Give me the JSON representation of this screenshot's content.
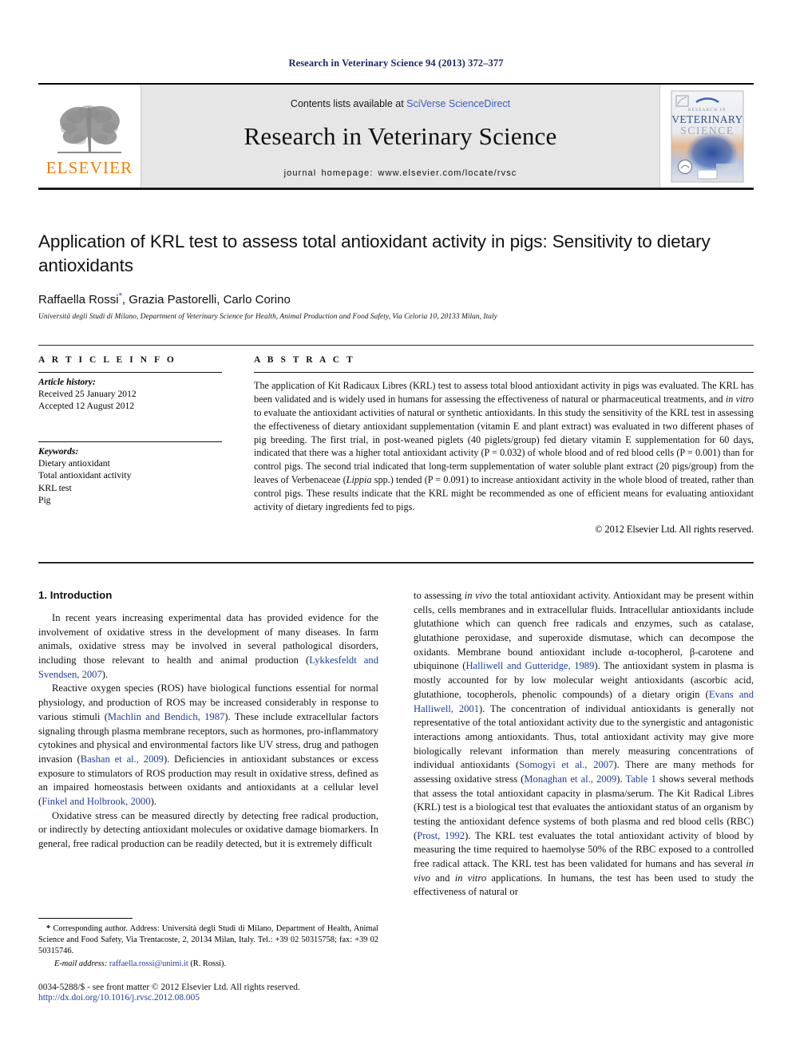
{
  "running_head": "Research in Veterinary Science 94 (2013) 372–377",
  "masthead": {
    "publisher_logo_text": "ELSEVIER",
    "contents_prefix": "Contents lists available at ",
    "contents_link": "SciVerse ScienceDirect",
    "journal_title": "Research in Veterinary Science",
    "homepage_label": "journal homepage: www.elsevier.com/locate/rvsc",
    "cover": {
      "line1": "RESEARCH IN",
      "line2": "VETERINARY",
      "line3": "SCIENCE"
    }
  },
  "title_block": {
    "title": "Application of KRL test to assess total antioxidant activity in pigs: Sensitivity to dietary antioxidants",
    "authors": "Raffaella Rossi",
    "author_marker": "*",
    "authors_rest": ", Grazia Pastorelli, Carlo Corino",
    "affiliation": "Università degli Studi di Milano, Department of Veterinary Science for Health, Animal Production and Food Safety, Via Celoria 10, 20133 Milan, Italy"
  },
  "article_info": {
    "heading": "A R T I C L E   I N F O",
    "history_head": "Article history:",
    "history_lines": [
      "Received 25 January 2012",
      "Accepted 12 August 2012"
    ],
    "keywords_head": "Keywords:",
    "keywords": [
      "Dietary antioxidant",
      "Total antioxidant activity",
      "KRL test",
      "Pig"
    ]
  },
  "abstract": {
    "heading": "A B S T R A C T",
    "text_parts": {
      "p1": "The application of Kit Radicaux Libres (KRL) test to assess total blood antioxidant activity in pigs was evaluated. The KRL has been validated and is widely used in humans for assessing the effectiveness of natural or pharmaceutical treatments, and ",
      "it1": "in vitro",
      "p2": " to evaluate the antioxidant activities of natural or synthetic antioxidants. In this study the sensitivity of the KRL test in assessing the effectiveness of dietary antioxidant supplementation (vitamin E and plant extract) was evaluated in two different phases of pig breeding. The first trial, in post-weaned piglets (40 piglets/group) fed dietary vitamin E supplementation for 60 days, indicated that there was a higher total antioxidant activity (P = 0.032) of whole blood and of red blood cells (P = 0.001) than for control pigs. The second trial indicated that long-term supplementation of water soluble plant extract (20 pigs/group) from the leaves of Verbenaceae (",
      "it2": "Lippia",
      "p3": " spp.) tended (P = 0.091) to increase antioxidant activity in the whole blood of treated, rather than control pigs. These results indicate that the KRL might be recommended as one of efficient means for evaluating antioxidant activity of dietary ingredients fed to pigs."
    },
    "copyright": "© 2012 Elsevier Ltd. All rights reserved."
  },
  "body": {
    "section_number_title": "1. Introduction",
    "left_column": {
      "p1_a": "In recent years increasing experimental data has provided evidence for the involvement of oxidative stress in the development of many diseases. In farm animals, oxidative stress may be involved in several pathological disorders, including those relevant to health and animal production (",
      "p1_ref": "Lykkesfeldt and Svendsen, 2007",
      "p1_b": ").",
      "p2_a": "Reactive oxygen species (ROS) have biological functions essential for normal physiology, and production of ROS may be increased considerably in response to various stimuli (",
      "p2_ref1": "Machlin and Bendich, 1987",
      "p2_b": "). These include extracellular factors signaling through plasma membrane receptors, such as hormones, pro-inflammatory cytokines and physical and environmental factors like UV stress, drug and pathogen invasion (",
      "p2_ref2": "Bashan et al., 2009",
      "p2_c": "). Deficiencies in antioxidant substances or excess exposure to stimulators of ROS production may result in oxidative stress, defined as an impaired homeostasis between oxidants and antioxidants at a cellular level (",
      "p2_ref3": "Finkel and Holbrook, 2000",
      "p2_d": ").",
      "p3": "Oxidative stress can be measured directly by detecting free radical production, or indirectly by detecting antioxidant molecules or oxidative damage biomarkers. In general, free radical production can be readily detected, but it is extremely difficult"
    },
    "right_column": {
      "p1_a": "to assessing ",
      "p1_it": "in vivo",
      "p1_b": " the total antioxidant activity. Antioxidant may be present within cells, cells membranes and in extracellular fluids. Intracellular antioxidants include glutathione which can quench free radicals and enzymes, such as catalase, glutathione peroxidase, and superoxide dismutase, which can decompose the oxidants. Membrane bound antioxidant include α-tocopherol, β-carotene and ubiquinone (",
      "p1_ref1": "Halliwell and Gutteridge, 1989",
      "p1_c": "). The antioxidant system in plasma is mostly accounted for by low molecular weight antioxidants (ascorbic acid, glutathione, tocopherols, phenolic compounds) of a dietary origin (",
      "p1_ref2": "Evans and Halliwell, 2001",
      "p1_d": "). The concentration of individual antioxidants is generally not representative of the total antioxidant activity due to the synergistic and antagonistic interactions among antioxidants. Thus, total antioxidant activity may give more biologically relevant information than merely measuring concentrations of individual antioxidants (",
      "p1_ref3": "Somogyi et al., 2007",
      "p1_e": "). There are many methods for assessing oxidative stress (",
      "p1_ref4": "Monaghan et al., 2009",
      "p1_f": "). ",
      "p1_ref5": "Table 1",
      "p1_g": " shows several methods that assess the total antioxidant capacity in plasma/serum. The Kit Radical Libres (KRL) test is a biological test that evaluates the antioxidant status of an organism by testing the antioxidant defence systems of both plasma and red blood cells (RBC) (",
      "p1_ref6": "Prost, 1992",
      "p1_h": "). The KRL test evaluates the total antioxidant activity of blood by measuring the time required to haemolyse 50% of the RBC exposed to a controlled free radical attack. The KRL test has been validated for humans and has several ",
      "p1_it2": "in vivo",
      "p1_i": " and ",
      "p1_it3": "in vitro",
      "p1_j": " applications. In humans, the test has been used to study the effectiveness of natural or"
    }
  },
  "footnote": {
    "marker": "*",
    "text": " Corresponding author. Address: Università degli Studi di Milano, Department of Health, Animal Science and Food Safety, Via Trentacoste, 2, 20134 Milan, Italy. Tel.: +39 02 50315758; fax: +39 02 50315746.",
    "email_label": "E-mail address:",
    "email": "raffaella.rossi@unimi.it",
    "email_suffix": " (R. Rossi)."
  },
  "footer": {
    "issn_line": "0034-5288/$ - see front matter © 2012 Elsevier Ltd. All rights reserved.",
    "doi": "http://dx.doi.org/10.1016/j.rvsc.2012.08.005"
  },
  "colors": {
    "running_head": "#1a2670",
    "link": "#1d3ea0",
    "elsevier_orange": "#F08000",
    "masthead_bg": "#e6e6e6"
  }
}
